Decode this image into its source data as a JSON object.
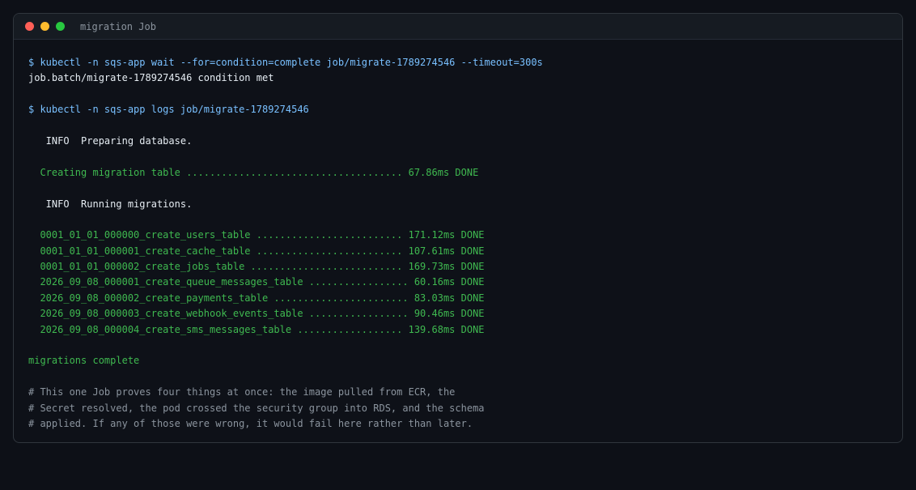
{
  "window": {
    "title": "migration Job"
  },
  "terminal": {
    "lines": [
      {
        "type": "cmd",
        "text": "$ kubectl -n sqs-app wait --for=condition=complete job/migrate-1789274546 --timeout=300s"
      },
      {
        "type": "out",
        "text": "job.batch/migrate-1789274546 condition met"
      },
      {
        "type": "blank",
        "text": ""
      },
      {
        "type": "cmd",
        "text": "$ kubectl -n sqs-app logs job/migrate-1789274546"
      },
      {
        "type": "blank",
        "text": ""
      },
      {
        "type": "info",
        "text": "   INFO  Preparing database."
      },
      {
        "type": "blank",
        "text": ""
      },
      {
        "type": "ok",
        "text": "  Creating migration table ..................................... 67.86ms DONE"
      },
      {
        "type": "blank",
        "text": ""
      },
      {
        "type": "info",
        "text": "   INFO  Running migrations."
      },
      {
        "type": "blank",
        "text": ""
      },
      {
        "type": "ok",
        "text": "  0001_01_01_000000_create_users_table ......................... 171.12ms DONE"
      },
      {
        "type": "ok",
        "text": "  0001_01_01_000001_create_cache_table ......................... 107.61ms DONE"
      },
      {
        "type": "ok",
        "text": "  0001_01_01_000002_create_jobs_table .......................... 169.73ms DONE"
      },
      {
        "type": "ok",
        "text": "  2026_09_08_000001_create_queue_messages_table ................. 60.16ms DONE"
      },
      {
        "type": "ok",
        "text": "  2026_09_08_000002_create_payments_table ....................... 83.03ms DONE"
      },
      {
        "type": "ok",
        "text": "  2026_09_08_000003_create_webhook_events_table ................. 90.46ms DONE"
      },
      {
        "type": "ok",
        "text": "  2026_09_08_000004_create_sms_messages_table .................. 139.68ms DONE"
      },
      {
        "type": "blank",
        "text": ""
      },
      {
        "type": "ok",
        "text": "migrations complete"
      },
      {
        "type": "blank",
        "text": ""
      },
      {
        "type": "comment",
        "text": "# This one Job proves four things at once: the image pulled from ECR, the"
      },
      {
        "type": "comment",
        "text": "# Secret resolved, the pod crossed the security group into RDS, and the schema"
      },
      {
        "type": "comment",
        "text": "# applied. If any of those were wrong, it would fail here rather than later."
      }
    ]
  }
}
